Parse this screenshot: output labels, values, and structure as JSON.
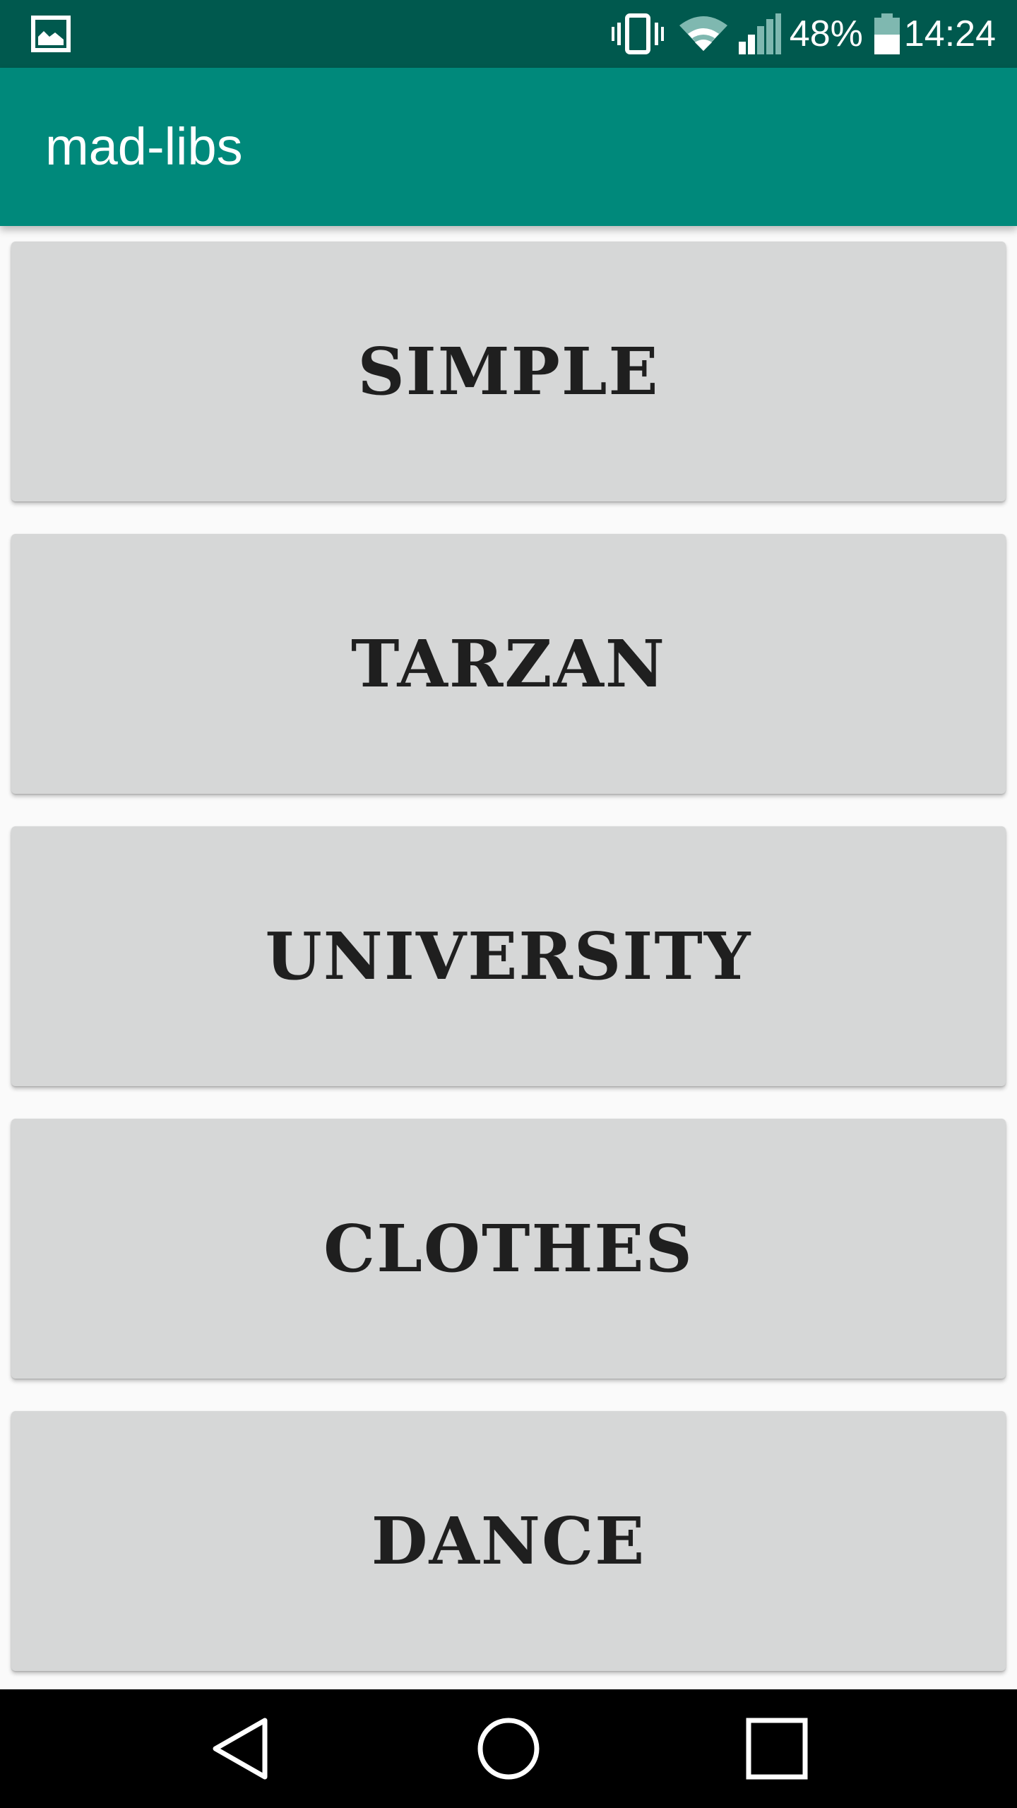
{
  "status_bar": {
    "notification_icon": "image-icon",
    "vibrate_icon": "vibrate-icon",
    "wifi_icon": "wifi-icon",
    "signal_icon": "cell-signal-icon",
    "battery_percent": "48%",
    "battery_icon": "battery-icon",
    "time": "14:24"
  },
  "app_bar": {
    "title": "mad-libs"
  },
  "stories": [
    {
      "label": "SIMPLE"
    },
    {
      "label": "TARZAN"
    },
    {
      "label": "UNIVERSITY"
    },
    {
      "label": "CLOTHES"
    },
    {
      "label": "DANCE"
    }
  ],
  "nav_bar": {
    "back_icon": "back-triangle-icon",
    "home_icon": "home-circle-icon",
    "recents_icon": "recents-square-icon"
  },
  "colors": {
    "status_bar": "#00594e",
    "primary": "#00897b",
    "button_bg": "#d6d7d7",
    "button_text": "#1f1f1f",
    "background": "#fafafa",
    "nav_bar": "#000000"
  }
}
